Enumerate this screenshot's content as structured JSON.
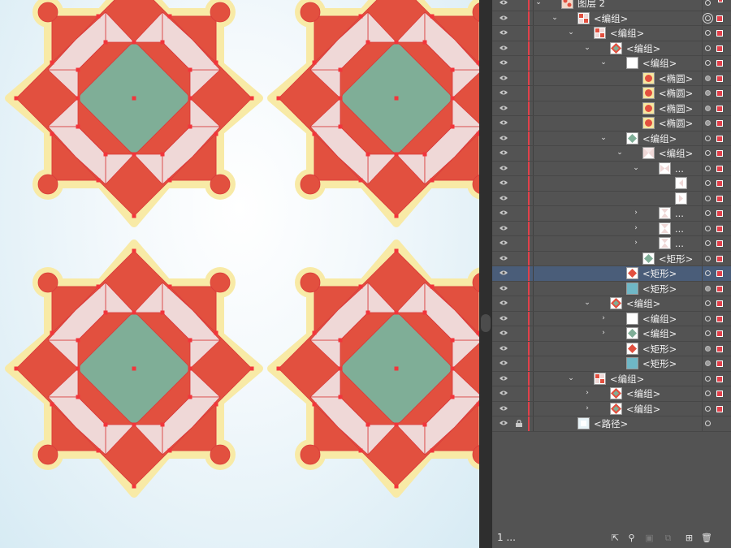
{
  "canvas": {
    "tiles": [
      "ornament-tile",
      "ornament-tile",
      "ornament-tile",
      "ornament-tile"
    ],
    "colors": {
      "cream": "#f8eaa6",
      "teal": "#6fb7c6",
      "red": "#e2503f",
      "pink": "#efd8d7",
      "green": "#7fae97",
      "anchor": "#f2353b",
      "outline": "#d93a3a"
    }
  },
  "layers_panel": {
    "rows": [
      {
        "label": "图层 2",
        "indent": 0,
        "expand": "open",
        "thumb": "layer-thumb",
        "target": "open",
        "sel": "small"
      },
      {
        "label": "<编组>",
        "indent": 1,
        "expand": "open",
        "thumb": "tile-thumb",
        "target": "double",
        "sel": "box"
      },
      {
        "label": "<编组>",
        "indent": 2,
        "expand": "open",
        "thumb": "tile-thumb",
        "target": "open",
        "sel": "box"
      },
      {
        "label": "<编组>",
        "indent": 3,
        "expand": "open",
        "thumb": "star-thumb",
        "target": "open",
        "sel": "box"
      },
      {
        "label": "<编组>",
        "indent": 4,
        "expand": "open",
        "thumb": "blank-thumb",
        "target": "open",
        "sel": "box"
      },
      {
        "label": "<椭圆>",
        "indent": 5,
        "expand": "",
        "thumb": "circle-thumb",
        "target": "filled",
        "sel": "box"
      },
      {
        "label": "<椭圆>",
        "indent": 5,
        "expand": "",
        "thumb": "circle-thumb",
        "target": "filled",
        "sel": "box"
      },
      {
        "label": "<椭圆>",
        "indent": 5,
        "expand": "",
        "thumb": "circle-thumb",
        "target": "filled",
        "sel": "box"
      },
      {
        "label": "<椭圆>",
        "indent": 5,
        "expand": "",
        "thumb": "circle-thumb",
        "target": "filled",
        "sel": "box"
      },
      {
        "label": "<编组>",
        "indent": 4,
        "expand": "open",
        "thumb": "green-diamond-thumb",
        "target": "open",
        "sel": "box"
      },
      {
        "label": "<编组>",
        "indent": 5,
        "expand": "open",
        "thumb": "pink-x-thumb",
        "target": "open",
        "sel": "box"
      },
      {
        "label": "...",
        "indent": 6,
        "expand": "open",
        "thumb": "bowtie-thumb",
        "target": "open",
        "sel": "box"
      },
      {
        "label": "",
        "indent": 7,
        "expand": "",
        "thumb": "tri-left-thumb",
        "target": "open",
        "sel": "box"
      },
      {
        "label": "",
        "indent": 7,
        "expand": "",
        "thumb": "tri-right-thumb",
        "target": "open",
        "sel": "box"
      },
      {
        "label": "...",
        "indent": 6,
        "expand": "closed",
        "thumb": "hourglass-thumb",
        "target": "open",
        "sel": "box"
      },
      {
        "label": "...",
        "indent": 6,
        "expand": "closed",
        "thumb": "hourglass-thumb",
        "target": "open",
        "sel": "box"
      },
      {
        "label": "...",
        "indent": 6,
        "expand": "closed",
        "thumb": "hourglass-thumb",
        "target": "open",
        "sel": "box"
      },
      {
        "label": "<矩形>",
        "indent": 5,
        "expand": "",
        "thumb": "green-diamond-thumb",
        "target": "open",
        "sel": "box"
      },
      {
        "label": "<矩形>",
        "indent": 4,
        "expand": "",
        "thumb": "red-diamond-thumb",
        "target": "open",
        "sel": "box",
        "selected": true
      },
      {
        "label": "<矩形>",
        "indent": 4,
        "expand": "",
        "thumb": "teal-square-thumb",
        "target": "filled",
        "sel": "box"
      },
      {
        "label": "<编组>",
        "indent": 3,
        "expand": "open",
        "thumb": "star-thumb",
        "target": "open",
        "sel": "box"
      },
      {
        "label": "<编组>",
        "indent": 4,
        "expand": "closed",
        "thumb": "blank-thumb",
        "target": "open",
        "sel": "box"
      },
      {
        "label": "<编组>",
        "indent": 4,
        "expand": "closed",
        "thumb": "green-diamond-thumb",
        "target": "open",
        "sel": "box"
      },
      {
        "label": "<矩形>",
        "indent": 4,
        "expand": "",
        "thumb": "red-diamond-thumb",
        "target": "filled",
        "sel": "box"
      },
      {
        "label": "<矩形>",
        "indent": 4,
        "expand": "",
        "thumb": "teal-square-thumb",
        "target": "filled",
        "sel": "box"
      },
      {
        "label": "<编组>",
        "indent": 2,
        "expand": "open",
        "thumb": "tile-thumb",
        "target": "open",
        "sel": "box"
      },
      {
        "label": "<编组>",
        "indent": 3,
        "expand": "closed",
        "thumb": "star-thumb",
        "target": "open",
        "sel": "box"
      },
      {
        "label": "<编组>",
        "indent": 3,
        "expand": "closed",
        "thumb": "star-thumb",
        "target": "open",
        "sel": "box"
      },
      {
        "label": "<路径>",
        "indent": 1,
        "expand": "",
        "thumb": "path-thumb",
        "target": "open",
        "sel": "none",
        "locked": true
      }
    ],
    "footer": {
      "count": "1 ...",
      "icons": [
        "export-icon",
        "search-icon",
        "clip-mask-icon",
        "sublayer-icon",
        "new-layer-icon",
        "trash-icon"
      ]
    }
  }
}
